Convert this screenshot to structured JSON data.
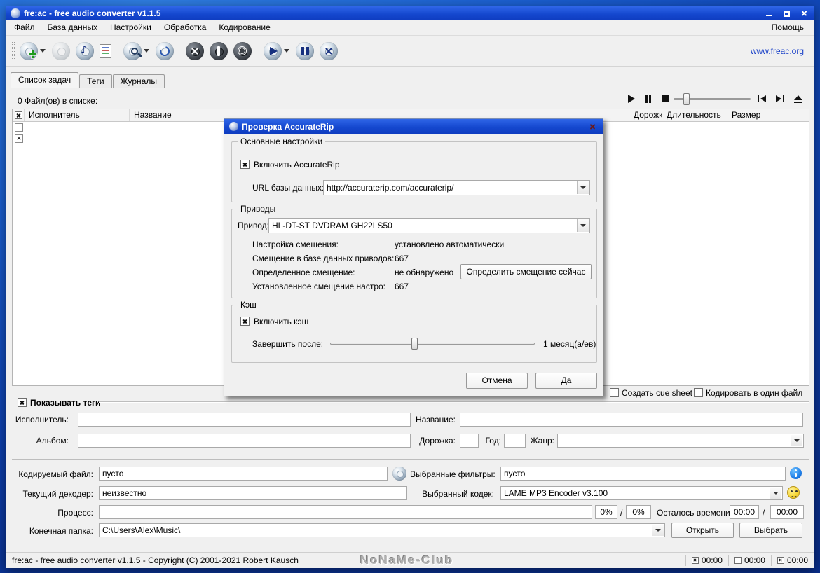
{
  "window": {
    "title": "fre:ac - free audio converter v1.1.5"
  },
  "menu": {
    "items": [
      "Файл",
      "База данных",
      "Настройки",
      "Обработка",
      "Кодирование"
    ],
    "help": "Помощь"
  },
  "toolbar": {
    "website": "www.freac.org"
  },
  "icons": {
    "note": "♪"
  },
  "tabs": {
    "joblist": "Список задач",
    "tags": "Теги",
    "logs": "Журналы"
  },
  "joblist": {
    "status": "0 Файл(ов) в списке:",
    "columns": {
      "artist": "Исполнитель",
      "title": "Название",
      "track": "Дорожка",
      "length": "Длительность",
      "size": "Размер"
    }
  },
  "dialog": {
    "title": "Проверка AccurateRip",
    "general": {
      "title": "Основные настройки",
      "enable": "Включить AccurateRip",
      "url_label": "URL базы данных:",
      "url": "http://accuraterip.com/accuraterip/"
    },
    "drives": {
      "title": "Приводы",
      "drive_label": "Привод:",
      "drive": "HL-DT-ST DVDRAM GH22LS50",
      "offset_label": "Настройка смещения:",
      "offset_value": "установлено автоматически",
      "db_offset_label": "Смещение в базе данных приводов:",
      "db_offset_value": "667",
      "detected_label": "Определенное смещение:",
      "detected_value": "не обнаружено",
      "detect_button": "Определить смещение сейчас",
      "configured_label": "Установленное смещение настро:",
      "configured_value": "667"
    },
    "cache": {
      "title": "Кэш",
      "enable": "Включить кэш",
      "expire_label": "Завершить после:",
      "expire_value": "1 месяц(а/ев)"
    },
    "cancel": "Отмена",
    "ok": "Да"
  },
  "options": {
    "cue": "Создать cue sheet",
    "single_file": "Кодировать в один файл"
  },
  "tags": {
    "show": "Показывать теги",
    "artist": "Исполнитель:",
    "title": "Название:",
    "album": "Альбом:",
    "track": "Дорожка:",
    "year": "Год:",
    "genre": "Жанр:"
  },
  "encoder": {
    "file_label": "Кодируемый файл:",
    "file": "пусто",
    "decoder_label": "Текущий декодер:",
    "decoder": "неизвестно",
    "filters_label": "Выбранные фильтры:",
    "filters": "пусто",
    "codec_label": "Выбранный кодек:",
    "codec": "LAME MP3 Encoder v3.100",
    "progress_label": "Процесс:",
    "progress_a": "0%",
    "progress_b": "0%",
    "sep": "/",
    "time_label": "Осталось времени:",
    "time_a": "00:00",
    "time_b": "00:00",
    "folder_label": "Конечная папка:",
    "folder": "C:\\Users\\Alex\\Music\\",
    "open": "Открыть",
    "select": "Выбрать"
  },
  "statusbar": {
    "text": "fre:ac - free audio converter v1.1.5 - Copyright (C) 2001-2021 Robert Kausch",
    "watermark": "NoNaMe-Club",
    "time1": "00:00",
    "time2": "00:00",
    "time3": "00:00"
  }
}
